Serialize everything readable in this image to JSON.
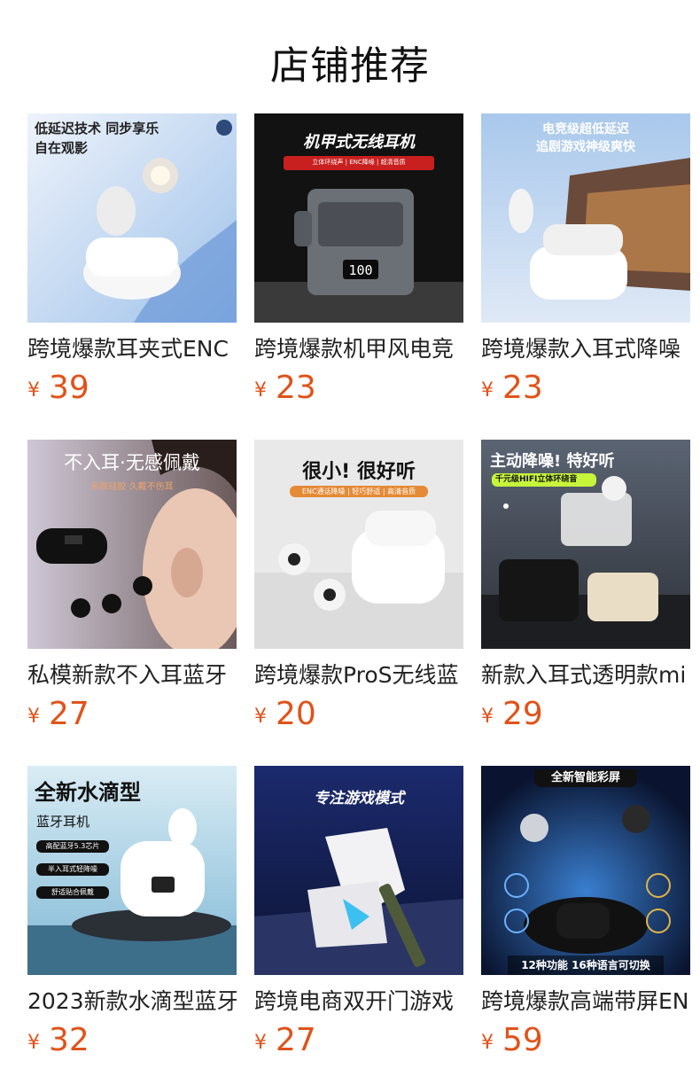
{
  "page": {
    "title": "店铺推荐"
  },
  "currency": "¥",
  "products": [
    {
      "name": "跨境爆款耳夹式ENC",
      "price": "39",
      "img_text": [
        "低延迟技术 同步享乐",
        "自在观影"
      ]
    },
    {
      "name": "跨境爆款机甲风电竞",
      "price": "23",
      "img_text": [
        "机甲式无线耳机",
        "立体环绕声 | ENC降噪 | 超清音质",
        "100"
      ]
    },
    {
      "name": "跨境爆款入耳式降噪",
      "price": "23",
      "img_text": [
        "电竞级超低延迟",
        "追剧游戏神级爽快"
      ]
    },
    {
      "name": "私模新款不入耳蓝牙",
      "price": "27",
      "img_text": [
        "不入耳·无感佩戴",
        "亲肤硅胶 久戴不伤耳"
      ]
    },
    {
      "name": "跨境爆款ProS无线蓝",
      "price": "20",
      "img_text": [
        "很小! 很好听",
        "ENC通话降噪 | 轻巧舒适 | 高清音质"
      ]
    },
    {
      "name": "新款入耳式透明款mi",
      "price": "29",
      "img_text": [
        "主动降噪! 特好听",
        "千元级HIFI立体环绕音"
      ]
    },
    {
      "name": "2023新款水滴型蓝牙",
      "price": "32",
      "img_text": [
        "全新水滴型",
        "蓝牙耳机",
        "高配蓝牙5.3芯片",
        "半入耳式轻降噪",
        "舒适贴合佩戴"
      ]
    },
    {
      "name": "跨境电商双开门游戏",
      "price": "27",
      "img_text": [
        "专注游戏模式"
      ]
    },
    {
      "name": "跨境爆款高端带屏EN",
      "price": "59",
      "img_text": [
        "全新智能彩屏",
        "12种功能  16种语言可切换"
      ]
    }
  ],
  "colors": {
    "price": "#e0531a",
    "title": "#111111"
  }
}
